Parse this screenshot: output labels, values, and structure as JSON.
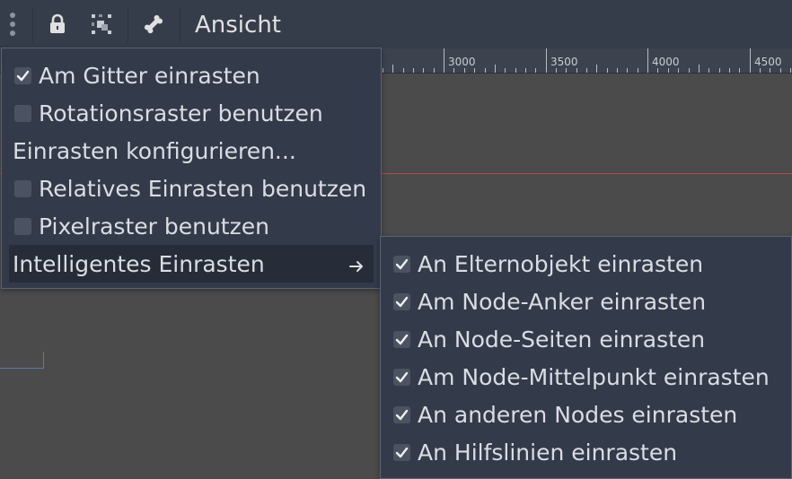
{
  "toolbar": {
    "view_label": "Ansicht",
    "icons": [
      "kebab-menu-icon",
      "lock-icon",
      "group-icon",
      "bone-icon"
    ]
  },
  "ruler": {
    "labels": [
      "3000",
      "3500",
      "4000",
      "4500"
    ]
  },
  "snap_menu": {
    "items": [
      {
        "label": "Am Gitter einrasten",
        "checkbox": true,
        "checked": true
      },
      {
        "label": "Rotationsraster benutzen",
        "checkbox": true,
        "checked": false
      },
      {
        "label": "Einrasten konfigurieren...",
        "checkbox": false
      },
      {
        "label": "Relatives Einrasten benutzen",
        "checkbox": true,
        "checked": false
      },
      {
        "label": "Pixelraster benutzen",
        "checkbox": true,
        "checked": false
      },
      {
        "label": "Intelligentes Einrasten",
        "checkbox": false,
        "submenu": true,
        "highlighted": true
      }
    ]
  },
  "smart_snap_submenu": {
    "items": [
      {
        "label": "An Elternobjekt einrasten",
        "checked": true
      },
      {
        "label": "Am Node-Anker einrasten",
        "checked": true
      },
      {
        "label": "An Node-Seiten einrasten",
        "checked": true
      },
      {
        "label": "Am Node-Mittelpunkt einrasten",
        "checked": true
      },
      {
        "label": "An anderen Nodes einrasten",
        "checked": true
      },
      {
        "label": "An Hilfslinien einrasten",
        "checked": true
      }
    ]
  },
  "colors": {
    "toolbar_bg": "#363d4a",
    "menu_bg": "#333b4a",
    "viewport_bg": "#4b4b4b",
    "guide_line": "#b24a4a"
  }
}
